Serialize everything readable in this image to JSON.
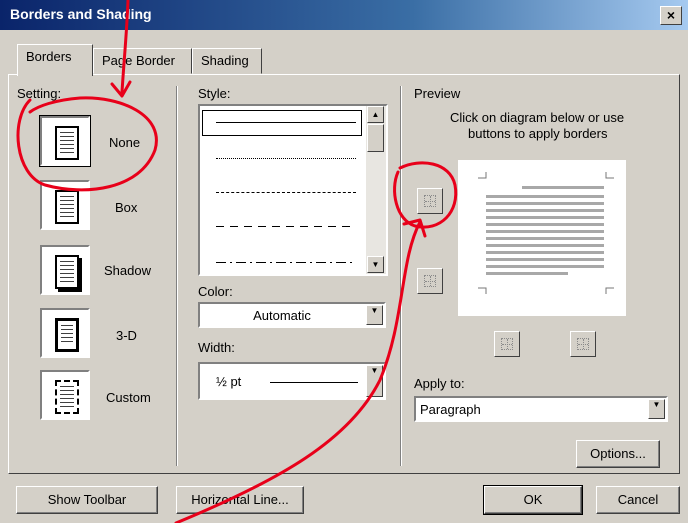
{
  "window": {
    "title": "Borders and Shading",
    "close_glyph": "×"
  },
  "tabs": [
    {
      "label": "Borders",
      "active": true
    },
    {
      "label": "Page Border",
      "active": false
    },
    {
      "label": "Shading",
      "active": false
    }
  ],
  "setting": {
    "header": "Setting:",
    "items": [
      {
        "label": "None",
        "selected": true
      },
      {
        "label": "Box",
        "selected": false
      },
      {
        "label": "Shadow",
        "selected": false
      },
      {
        "label": "3-D",
        "selected": false
      },
      {
        "label": "Custom",
        "selected": false
      }
    ]
  },
  "style": {
    "header": "Style:",
    "line_styles": [
      "solid",
      "dotted",
      "dashed",
      "long-dashed",
      "dash-dot"
    ]
  },
  "color": {
    "header": "Color:",
    "value": "Automatic"
  },
  "width": {
    "header": "Width:",
    "value": "½ pt"
  },
  "preview": {
    "header": "Preview",
    "instructions_line1": "Click on diagram below or use",
    "instructions_line2": "buttons to apply borders"
  },
  "apply_to": {
    "header": "Apply to:",
    "value": "Paragraph"
  },
  "buttons": {
    "options": "Options...",
    "show_toolbar": "Show Toolbar",
    "horizontal_line": "Horizontal Line...",
    "ok": "OK",
    "cancel": "Cancel"
  },
  "colors": {
    "title_bar": "#0a246a",
    "dialog_bg": "#d4d0c8",
    "annotation": "#e8001a"
  }
}
